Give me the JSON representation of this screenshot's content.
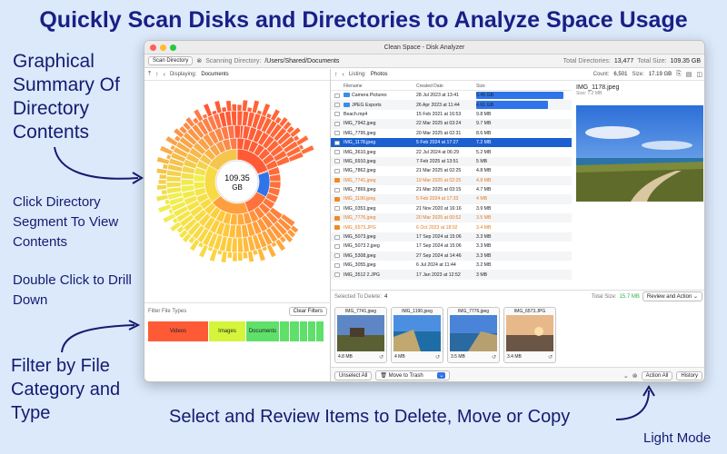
{
  "headline": "Quickly Scan Disks and Directories to Analyze Space Usage",
  "annotations": {
    "summary": "Graphical Summary Of Directory Contents",
    "click_segment": "Click Directory Segment To View Contents",
    "double_click": "Double Click to Drill Down",
    "filter": "Filter by File Category and Type",
    "bottom": "Select and Review Items to Delete, Move or Copy",
    "mode": "Light Mode"
  },
  "window": {
    "title": "Clean Space - Disk Analyzer",
    "scan_button": "Scan Directory",
    "scanning_label": "Scanning Directory:",
    "scanning_path": "/Users/Shared/Documents",
    "total_dirs_label": "Total Directories:",
    "total_dirs": "13,477",
    "total_size_label": "Total Size:",
    "total_size": "109.35 GB"
  },
  "left": {
    "displaying_label": "Displaying:",
    "displaying": "Documents",
    "center_size": "109.35",
    "center_unit": "GB",
    "filter_label": "Filter File Types",
    "clear_filters": "Clear Filters",
    "filters": [
      {
        "label": "Videos",
        "color": "#ff5a36"
      },
      {
        "label": "Images",
        "color": "#d4f53a"
      },
      {
        "label": "Documents",
        "color": "#5fe06a"
      }
    ]
  },
  "listing": {
    "label": "Listing:",
    "folder": "Photos",
    "count_label": "Count:",
    "count": "6,501",
    "size_label": "Size:",
    "size": "17.19 GB",
    "columns": {
      "name": "Filename",
      "date": "Created Date",
      "size": "Size"
    },
    "rows": [
      {
        "name": "Camera Pictures",
        "date": "28 Jul 2023 at 13:41",
        "size": "5.45 GB",
        "fill": 1.0,
        "folder": true
      },
      {
        "name": "JPEG Exports",
        "date": "26 Apr 2023 at 11:44",
        "size": "4.61 GB",
        "fill": 0.82,
        "folder": true
      },
      {
        "name": "Beach.mp4",
        "date": "15 Feb 2021 at 16:53",
        "size": "9.8 MB",
        "fill": 0
      },
      {
        "name": "IMG_7942.jpeg",
        "date": "22 Mar 2025 at 03:24",
        "size": "9.7 MB",
        "fill": 0
      },
      {
        "name": "IMG_7795.jpeg",
        "date": "20 Mar 2025 at 02:31",
        "size": "8.6 MB",
        "fill": 0
      },
      {
        "name": "IMG_1178.jpeg",
        "date": "5 Feb 2024 at 17:27",
        "size": "7.2 MB",
        "fill": 0,
        "selected": true
      },
      {
        "name": "IMG_3610.jpeg",
        "date": "22 Jul 2024 at 06:29",
        "size": "5.2 MB",
        "fill": 0
      },
      {
        "name": "IMG_6910.jpeg",
        "date": "7 Feb 2025 at 13:51",
        "size": "5 MB",
        "fill": 0
      },
      {
        "name": "IMG_7862.jpeg",
        "date": "21 Mar 2025 at 02:25",
        "size": "4.8 MB",
        "fill": 0
      },
      {
        "name": "IMG_7741.jpeg",
        "date": "19 Mar 2025 at 02:25",
        "size": "4.8 MB",
        "fill": 0,
        "flagged": true
      },
      {
        "name": "IMG_7869.jpeg",
        "date": "21 Mar 2025 at 03:15",
        "size": "4.7 MB",
        "fill": 0
      },
      {
        "name": "IMG_1190.jpeg",
        "date": "5 Feb 2024 at 17:33",
        "size": "4 MB",
        "fill": 0,
        "flagged": true
      },
      {
        "name": "IMG_0353.jpeg",
        "date": "21 Nov 2020 at 16:16",
        "size": "3.9 MB",
        "fill": 0
      },
      {
        "name": "IMG_7776.jpeg",
        "date": "20 Mar 2025 at 00:52",
        "size": "3.5 MB",
        "fill": 0,
        "flagged": true
      },
      {
        "name": "IMG_6573.JPG",
        "date": "6 Oct 2023 at 18:02",
        "size": "3.4 MB",
        "fill": 0,
        "flagged": true
      },
      {
        "name": "IMG_5073.jpeg",
        "date": "17 Sep 2024 at 15:06",
        "size": "3.3 MB",
        "fill": 0
      },
      {
        "name": "IMG_5073 2.jpeg",
        "date": "17 Sep 2024 at 15:06",
        "size": "3.3 MB",
        "fill": 0
      },
      {
        "name": "IMG_5308.jpeg",
        "date": "27 Sep 2024 at 14:46",
        "size": "3.3 MB",
        "fill": 0
      },
      {
        "name": "IMG_3055.jpeg",
        "date": "6 Jul 2024 at 11:44",
        "size": "3.2 MB",
        "fill": 0
      },
      {
        "name": "IMG_3512 2.JPG",
        "date": "17 Jan 2023 at 12:52",
        "size": "3 MB",
        "fill": 0
      }
    ]
  },
  "preview": {
    "title": "IMG_1178.jpeg",
    "size_label": "Size:",
    "size": "7.2 MB"
  },
  "delete": {
    "label": "Selected To Delete:",
    "count": "4",
    "total_label": "Total Size:",
    "total": "15.7 MB",
    "review_button": "Review and Action",
    "thumbs": [
      {
        "name": "IMG_7741.jpeg",
        "size": "4.8 MB"
      },
      {
        "name": "IMG_1190.jpeg",
        "size": "4 MB"
      },
      {
        "name": "IMG_7776.jpeg",
        "size": "3.5 MB"
      },
      {
        "name": "IMG_6573.JPG",
        "size": "3.4 MB"
      }
    ]
  },
  "actions": {
    "unselect_all": "Unselect All",
    "action_select": "Move to Trash",
    "action_all": "Action All",
    "history": "History"
  },
  "colors": {
    "accent": "#1b5fd1",
    "flag": "#e57b1c",
    "headline": "#1a1f86"
  }
}
